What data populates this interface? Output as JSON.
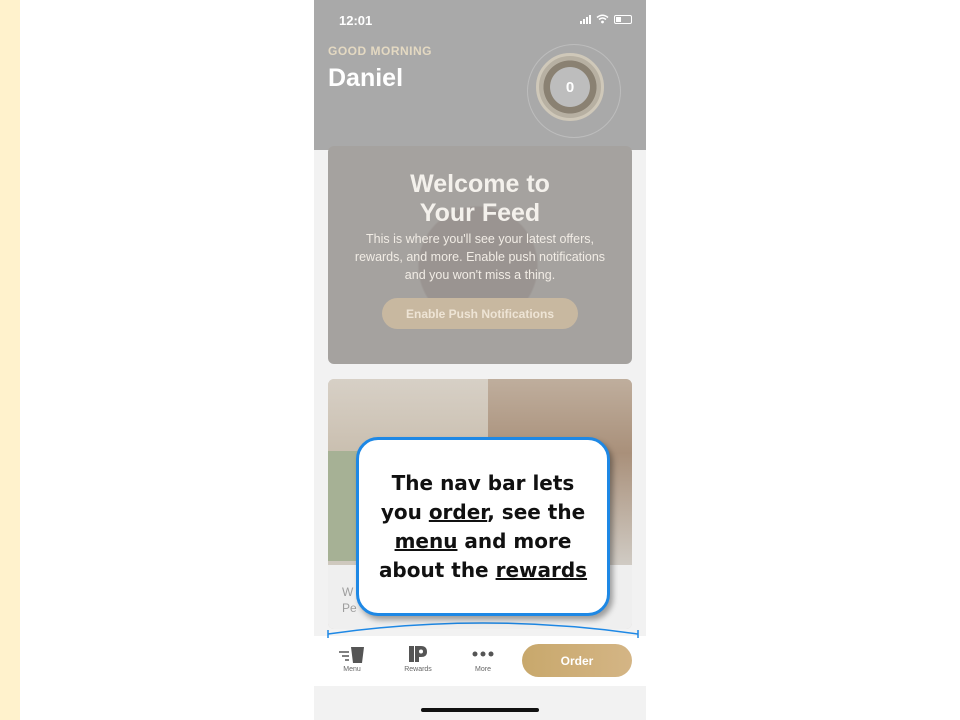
{
  "status_bar": {
    "time": "12:01"
  },
  "header": {
    "greeting": "GOOD MORNING",
    "user_name": "Daniel",
    "points": "0"
  },
  "welcome_card": {
    "title_line1": "Welcome to",
    "title_line2": "Your Feed",
    "body_line1": "This is where you'll see your latest offers,",
    "body_line2": "rewards, and more. Enable push notifications",
    "body_line3": "and you won't miss a thing.",
    "button_label": "Enable Push Notifications"
  },
  "promo_card": {
    "text_line1": "W",
    "text_line2": "Pe"
  },
  "nav": {
    "menu_label": "Menu",
    "rewards_label": "Rewards",
    "more_label": "More",
    "order_label": "Order"
  },
  "callout": {
    "line1": "The nav bar lets",
    "line2_prefix": "you ",
    "line2_link": "order",
    "line2_suffix": ", see the",
    "line3_link": "menu",
    "line3_suffix": " and more",
    "line4_prefix": "about the ",
    "line4_link": "rewards"
  },
  "colors": {
    "accent_blue": "#1e88e5",
    "order_gold": "#c8a86c",
    "side_strip": "#fff2cc"
  },
  "icons": [
    "cup-icon",
    "rewards-p-icon",
    "more-dots-icon",
    "signal-icon",
    "wifi-icon",
    "battery-icon"
  ]
}
